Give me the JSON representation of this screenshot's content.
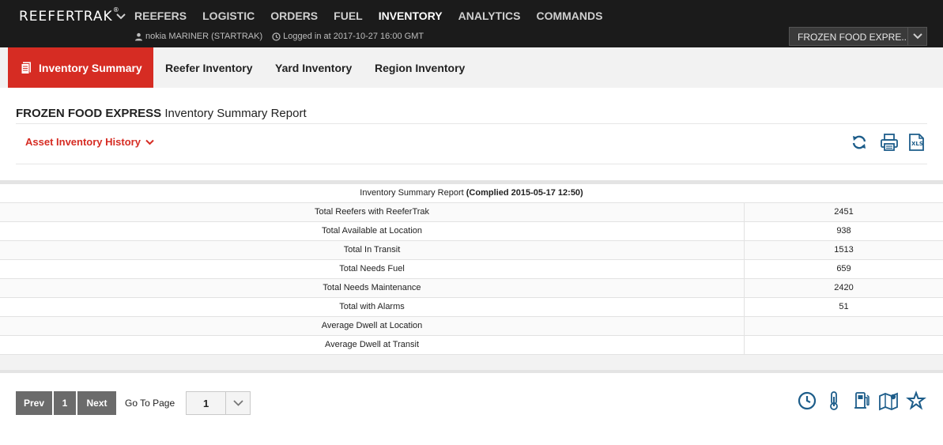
{
  "header": {
    "brand": "REEFERTRAK",
    "brand_mark": "®",
    "nav": [
      "REEFERS",
      "LOGISTIC",
      "ORDERS",
      "FUEL",
      "INVENTORY",
      "ANALYTICS",
      "COMMANDS"
    ],
    "active_nav": "INVENTORY",
    "user": "nokia MARINER (STARTRAK)",
    "login": "Logged in at 2017-10-27 16:00 GMT",
    "company": "FROZEN FOOD EXPRE..."
  },
  "tabs": [
    "Inventory Summary",
    "Reefer Inventory",
    "Yard Inventory",
    "Region Inventory"
  ],
  "report": {
    "company": "FROZEN FOOD EXPRESS",
    "title": "Inventory Summary Report",
    "history_label": "Asset Inventory History"
  },
  "table": {
    "caption": "Inventory Summary Report",
    "caption_bold": "(Complied 2015-05-17 12:50)",
    "rows": [
      {
        "label": "Total Reefers with ReeferTrak",
        "value": "2451"
      },
      {
        "label": "Total Available at Location",
        "value": "938"
      },
      {
        "label": "Total In Transit",
        "value": "1513"
      },
      {
        "label": "Total Needs Fuel",
        "value": "659"
      },
      {
        "label": "Total Needs Maintenance",
        "value": "2420"
      },
      {
        "label": "Total with Alarms",
        "value": "51"
      },
      {
        "label": "Average Dwell at Location",
        "value": ""
      },
      {
        "label": "Average Dwell at Transit",
        "value": ""
      }
    ]
  },
  "pager": {
    "prev": "Prev",
    "page": "1",
    "next": "Next",
    "goto_label": "Go To Page",
    "goto_value": "1"
  },
  "icons": {
    "toolbar": [
      "refresh-icon",
      "print-icon",
      "xls-export-icon"
    ],
    "bottom": [
      "clock-icon",
      "thermometer-icon",
      "fuel-icon",
      "map-icon",
      "star-icon"
    ]
  },
  "colors": {
    "accent_red": "#d62c23",
    "topbar": "#1b1b1b",
    "icon_blue": "#1d5d8a",
    "pager_gray": "#6b6b6b"
  }
}
